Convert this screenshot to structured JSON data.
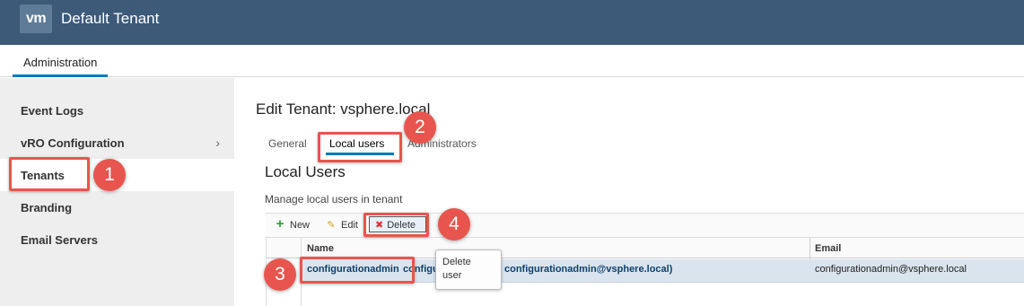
{
  "header": {
    "logo_text": "vm",
    "title": "Default Tenant"
  },
  "nav": {
    "active_tab": "Administration"
  },
  "sidebar": {
    "items": [
      {
        "label": "Event Logs",
        "has_chevron": false
      },
      {
        "label": "vRO Configuration",
        "has_chevron": true,
        "chevron": "›"
      },
      {
        "label": "Tenants",
        "active": true
      },
      {
        "label": "Branding"
      },
      {
        "label": "Email Servers"
      }
    ]
  },
  "main": {
    "title": "Edit Tenant: vsphere.local",
    "tabs": [
      "General",
      "Local users",
      "Administrators"
    ],
    "selected_tab": "Local users",
    "section_title": "Local Users",
    "section_desc": "Manage local users in tenant",
    "toolbar": {
      "new_label": "New",
      "edit_label": "Edit",
      "delete_label": "Delete"
    },
    "grid": {
      "columns": [
        "Name",
        "Email"
      ],
      "rows": [
        {
          "name": "configurationadmin  configurationadmin (configurationadmin@vsphere.local)",
          "name_visible_left": "configurationadmin",
          "name_fragment": "configu",
          "name_tail": "configurationadmin@vsphere.local)",
          "email": "configurationadmin@vsphere.local"
        }
      ]
    },
    "tooltip": {
      "line1": "Delete",
      "line2": "user"
    }
  },
  "annotations": {
    "b1": "1",
    "b2": "2",
    "b3": "3",
    "b4": "4"
  },
  "colors": {
    "header": "#3d5a78",
    "accent": "#0079b8",
    "annotation": "#e8554e",
    "row_selected": "#d9e4ee"
  }
}
